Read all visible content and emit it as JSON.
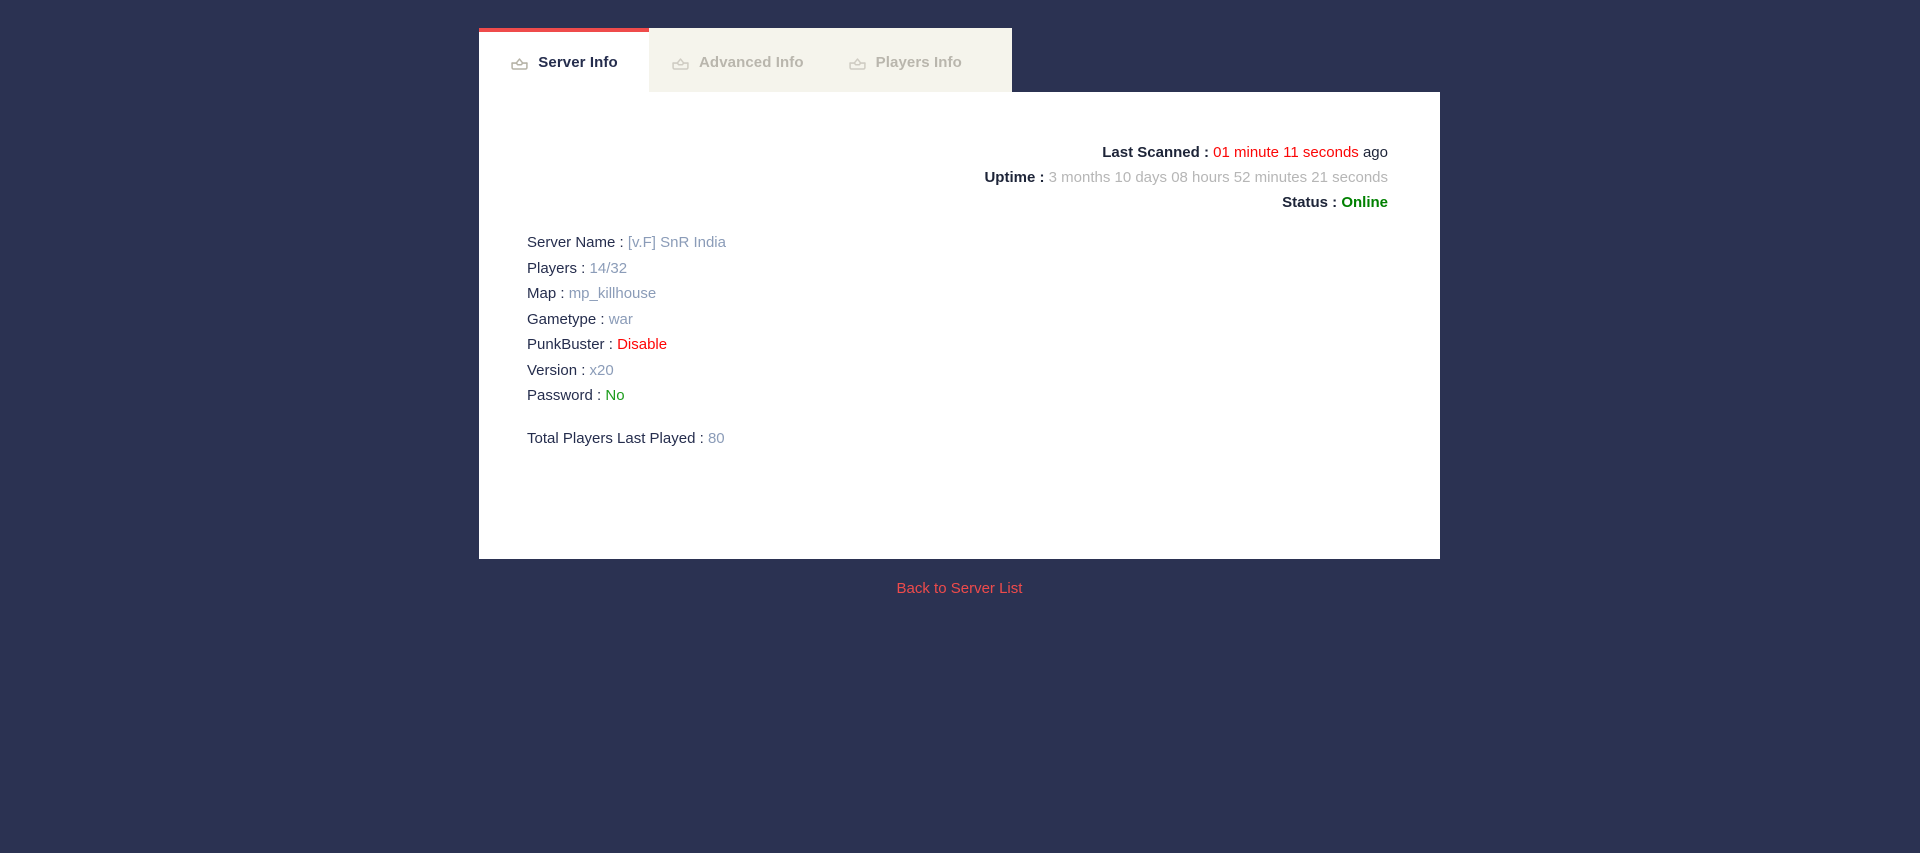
{
  "theme": {
    "background": "#2b3252",
    "card_background": "#ffffff",
    "tab_strip_background": "#f5f4ec",
    "accent_red": "#ef4b4b",
    "label_navy": "#252d4d",
    "value_blue": "#8b9cb8",
    "value_gray": "#b6b6b6",
    "online_green": "#008000",
    "alert_red": "#fb0606"
  },
  "tabs": [
    {
      "label": "Server Info",
      "icon": "inbox-icon",
      "active": true
    },
    {
      "label": "Advanced Info",
      "icon": "inbox-icon",
      "active": false
    },
    {
      "label": "Players Info",
      "icon": "inbox-icon",
      "active": false
    }
  ],
  "status": {
    "last_scanned_label": "Last Scanned :",
    "last_scanned_value": "01 minute 11 seconds",
    "last_scanned_suffix": "ago",
    "uptime_label": "Uptime :",
    "uptime_value": "3 months 10 days 08 hours 52 minutes 21 seconds",
    "status_label": "Status :",
    "status_value": "Online"
  },
  "details": {
    "server_name_label": "Server Name :",
    "server_name_value": "[v.F] SnR India",
    "players_label": "Players :",
    "players_value": "14/32",
    "map_label": "Map :",
    "map_value": "mp_killhouse",
    "gametype_label": "Gametype :",
    "gametype_value": "war",
    "punkbuster_label": "PunkBuster :",
    "punkbuster_value": "Disable",
    "version_label": "Version :",
    "version_value": "x20",
    "password_label": "Password :",
    "password_value": "No",
    "total_players_label": "Total Players Last Played :",
    "total_players_value": "80"
  },
  "footer": {
    "back_link": "Back to Server List"
  }
}
